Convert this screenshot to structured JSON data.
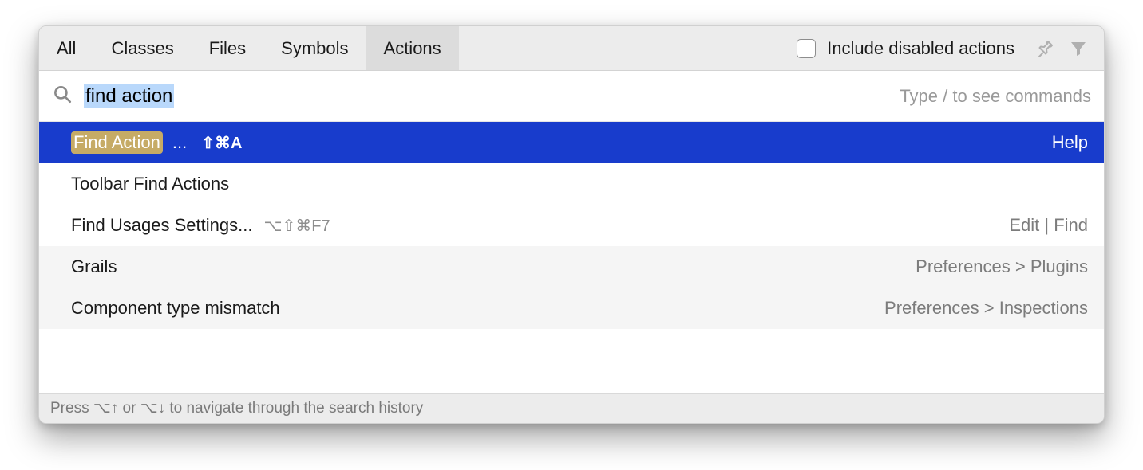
{
  "tabs": [
    {
      "label": "All",
      "active": false
    },
    {
      "label": "Classes",
      "active": false
    },
    {
      "label": "Files",
      "active": false
    },
    {
      "label": "Symbols",
      "active": false
    },
    {
      "label": "Actions",
      "active": true
    }
  ],
  "include_disabled": {
    "label": "Include disabled actions",
    "checked": false
  },
  "search": {
    "query": "find action",
    "hint": "Type / to see commands"
  },
  "results": [
    {
      "name_highlight": "Find Action",
      "name_rest": "...",
      "shortcut": "⇧⌘A",
      "context": "Help",
      "selected": true
    },
    {
      "name": "Toolbar Find Actions",
      "context": "",
      "selected": false
    },
    {
      "name": "Find Usages Settings...",
      "shortcut": "⌥⇧⌘F7",
      "context": "Edit | Find",
      "selected": false
    },
    {
      "name": "Grails",
      "context": "Preferences > Plugins",
      "selected": false,
      "alt": true
    },
    {
      "name": "Component type mismatch",
      "context": "Preferences > Inspections",
      "selected": false,
      "alt": true
    }
  ],
  "footer": "Press ⌥↑ or ⌥↓ to navigate through the search history"
}
